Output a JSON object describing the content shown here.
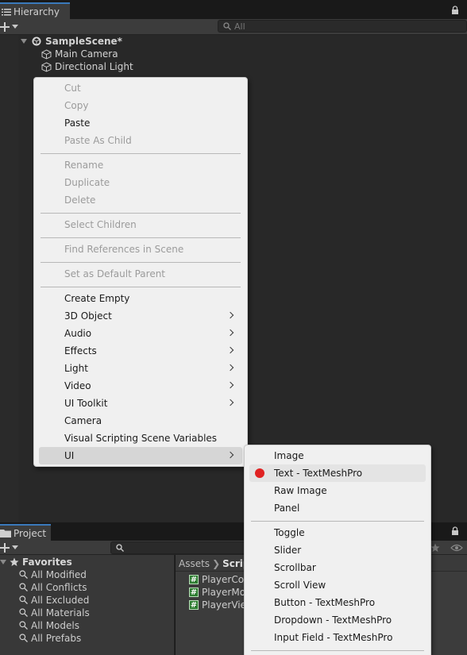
{
  "hierarchy": {
    "tab_label": "Hierarchy",
    "search_placeholder": "All",
    "scene_name": "SampleScene*",
    "objects": [
      {
        "name": "Main Camera"
      },
      {
        "name": "Directional Light"
      }
    ]
  },
  "context_menu": {
    "items": [
      {
        "label": "Cut",
        "enabled": false
      },
      {
        "label": "Copy",
        "enabled": false
      },
      {
        "label": "Paste",
        "enabled": true
      },
      {
        "label": "Paste As Child",
        "enabled": false
      },
      {
        "label": "Rename",
        "enabled": false
      },
      {
        "label": "Duplicate",
        "enabled": false
      },
      {
        "label": "Delete",
        "enabled": false
      },
      {
        "label": "Select Children",
        "enabled": false
      },
      {
        "label": "Find References in Scene",
        "enabled": false
      },
      {
        "label": "Set as Default Parent",
        "enabled": false
      },
      {
        "label": "Create Empty",
        "enabled": true
      },
      {
        "label": "3D Object",
        "enabled": true,
        "submenu": true
      },
      {
        "label": "Audio",
        "enabled": true,
        "submenu": true
      },
      {
        "label": "Effects",
        "enabled": true,
        "submenu": true
      },
      {
        "label": "Light",
        "enabled": true,
        "submenu": true
      },
      {
        "label": "Video",
        "enabled": true,
        "submenu": true
      },
      {
        "label": "UI Toolkit",
        "enabled": true,
        "submenu": true
      },
      {
        "label": "Camera",
        "enabled": true
      },
      {
        "label": "Visual Scripting Scene Variables",
        "enabled": true
      },
      {
        "label": "UI",
        "enabled": true,
        "submenu": true,
        "active": true
      }
    ]
  },
  "ui_submenu": {
    "items": [
      {
        "label": "Image"
      },
      {
        "label": "Text - TextMeshPro",
        "highlighted": true
      },
      {
        "label": "Raw Image"
      },
      {
        "label": "Panel"
      },
      {
        "label": "Toggle"
      },
      {
        "label": "Slider"
      },
      {
        "label": "Scrollbar"
      },
      {
        "label": "Scroll View"
      },
      {
        "label": "Button - TextMeshPro"
      },
      {
        "label": "Dropdown - TextMeshPro"
      },
      {
        "label": "Input Field - TextMeshPro"
      }
    ],
    "marker_color": "#e02222"
  },
  "project": {
    "tab_label": "Project",
    "favorites_label": "Favorites",
    "favorites": [
      "All Modified",
      "All Conflicts",
      "All Excluded",
      "All Materials",
      "All Models",
      "All Prefabs"
    ],
    "breadcrumb": {
      "root": "Assets",
      "current": "Scrip"
    },
    "scripts": [
      "PlayerCo",
      "PlayerMo",
      "PlayerVie"
    ]
  },
  "colors": {
    "tab_accent": "#3a79bb",
    "menu_bg": "#f0f0f0",
    "editor_bg": "#282828",
    "script_icon": "#2e7d32"
  }
}
